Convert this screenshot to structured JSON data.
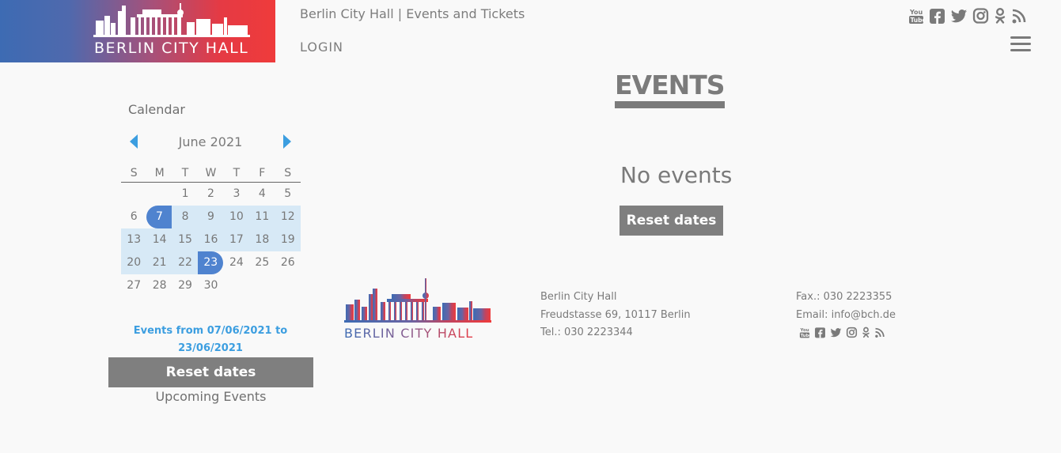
{
  "header": {
    "logo_text": "BERLIN CITY HALL",
    "site_title": "Berlin City Hall | Events and Tickets",
    "login_label": "LOGIN",
    "social_icons": [
      "youtube-icon",
      "facebook-icon",
      "twitter-icon",
      "instagram-icon",
      "odnoklassniki-icon",
      "rss-icon"
    ]
  },
  "calendar": {
    "label": "Calendar",
    "month": "June 2021",
    "weekdays": [
      "S",
      "M",
      "T",
      "W",
      "T",
      "F",
      "S"
    ],
    "weeks": [
      [
        "",
        "",
        "1",
        "2",
        "3",
        "4",
        "5"
      ],
      [
        "6",
        "7",
        "8",
        "9",
        "10",
        "11",
        "12"
      ],
      [
        "13",
        "14",
        "15",
        "16",
        "17",
        "18",
        "19"
      ],
      [
        "20",
        "21",
        "22",
        "23",
        "24",
        "25",
        "26"
      ],
      [
        "27",
        "28",
        "29",
        "30",
        "",
        "",
        ""
      ]
    ],
    "range_start": "7",
    "range_end": "23",
    "range_text": "Events from 07/06/2021 to 23/06/2021",
    "reset_label": "Reset dates",
    "upcoming_label": "Upcoming Events"
  },
  "main": {
    "title": "EVENTS",
    "no_events": "No events",
    "reset_label": "Reset dates"
  },
  "footer": {
    "logo_text": "BERLIN CITY HALL",
    "name": "Berlin City Hall",
    "address": "Freudstasse 69, 10117 Berlin",
    "tel": "Tel.: 030 2223344",
    "fax": "Fax.: 030 2223355",
    "email": "Email: info@bch.de"
  },
  "colors": {
    "accent_blue": "#3c9ee0",
    "selected_day": "#4f83cf",
    "range_fill": "#d7e9f6",
    "button_gray": "#7f7f7f",
    "brand_red": "#ef3b3b",
    "brand_blue": "#3d6bb3"
  }
}
